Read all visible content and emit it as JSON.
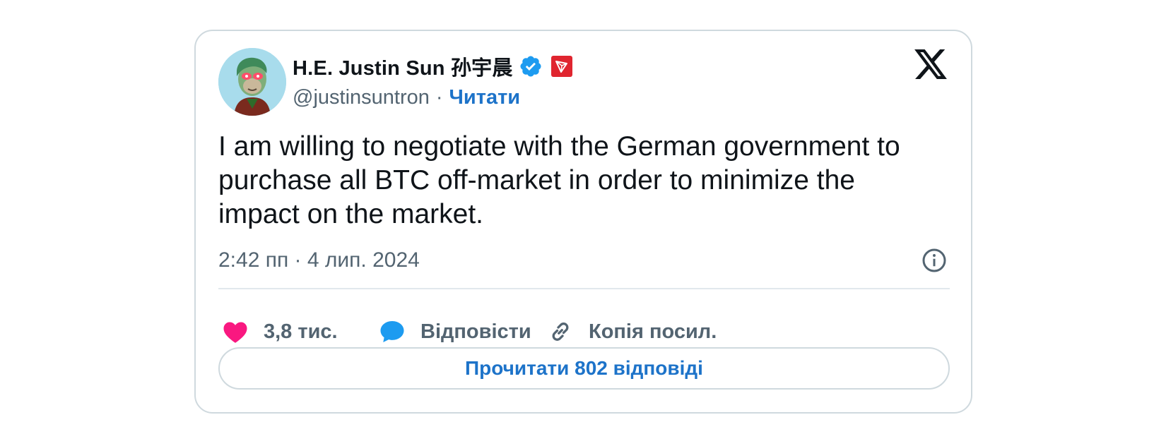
{
  "author": {
    "display_name": "H.E. Justin Sun 孙宇晨",
    "handle": "@justinsuntron",
    "separator": "·",
    "follow_label": "Читати"
  },
  "tweet": {
    "text": "I am willing to negotiate with the German government to purchase all BTC off-market in order to minimize the impact on the market.",
    "timestamp": "2:42 пп · 4 лип. 2024"
  },
  "actions": {
    "like_count": "3,8 тис.",
    "reply_label": "Відповісти",
    "copy_link_label": "Копія посил."
  },
  "read_replies_label": "Прочитати 802 відповіді",
  "icons": {
    "verified": "verified-badge-icon",
    "affiliate": "tron-logo-icon",
    "brand": "x-logo-icon",
    "info": "info-icon",
    "like": "heart-icon",
    "reply": "speech-bubble-icon",
    "copy_link": "link-icon"
  },
  "colors": {
    "link_blue": "#1d73c9",
    "verified_blue": "#1d9bf0",
    "like_pink": "#f91880",
    "secondary_text": "#536471",
    "primary_text": "#0f1419",
    "border": "#cfd9de",
    "tron_red": "#e0252f"
  }
}
